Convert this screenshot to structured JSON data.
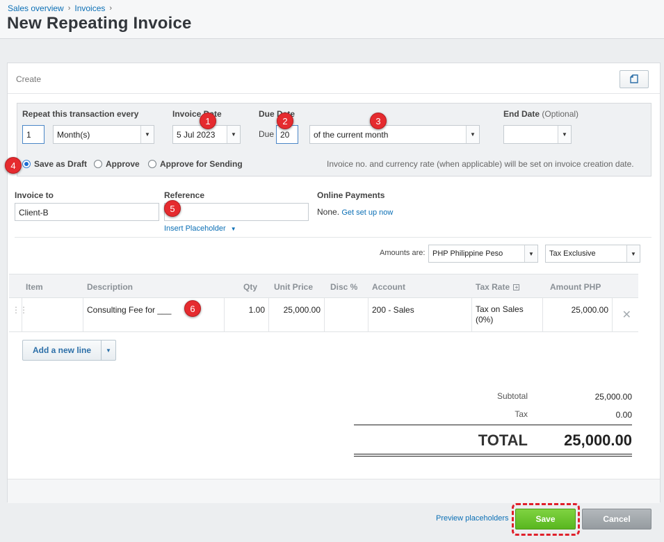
{
  "breadcrumb": {
    "item1": "Sales overview",
    "item2": "Invoices",
    "sep": "›"
  },
  "page_title": "New Repeating Invoice",
  "panel": {
    "header_label": "Create",
    "copy_icon": "copy-icon"
  },
  "repeat": {
    "repeat_label": "Repeat this transaction every",
    "interval_value": "1",
    "period_value": "Month(s)",
    "invoice_date_label": "Invoice Date",
    "invoice_date_value": "5 Jul 2023",
    "due_date_label": "Due Date",
    "due_prefix": "Due",
    "due_day_value": "20",
    "due_rule_value": "of the current month",
    "end_date_label": "End Date",
    "end_date_optional": "(Optional)",
    "end_date_value": ""
  },
  "approval": {
    "save_as_draft": "Save as Draft",
    "approve": "Approve",
    "approve_for_sending": "Approve for Sending",
    "selected": "Save as Draft",
    "note": "Invoice no. and currency rate (when applicable) will be set on invoice creation date."
  },
  "invoice": {
    "invoice_to_label": "Invoice to",
    "invoice_to_value": "Client-B",
    "reference_label": "Reference",
    "reference_value": "",
    "insert_placeholder": "Insert Placeholder",
    "online_payments_label": "Online Payments",
    "online_payments_none": "None.",
    "get_set_up": "Get set up now"
  },
  "amounts": {
    "amounts_are_label": "Amounts are:",
    "currency_value": "PHP Philippine Peso",
    "tax_mode_value": "Tax Exclusive"
  },
  "table": {
    "headers": [
      "Item",
      "Description",
      "Qty",
      "Unit Price",
      "Disc %",
      "Account",
      "Tax Rate",
      "Amount PHP"
    ],
    "rows": [
      {
        "item": "",
        "description": "Consulting Fee for ___",
        "qty": "1.00",
        "unit_price": "25,000.00",
        "disc": "",
        "account": "200 - Sales",
        "tax_rate": "Tax on Sales (0%)",
        "amount": "25,000.00"
      }
    ],
    "add_line": "Add a new line"
  },
  "totals": {
    "subtotal_label": "Subtotal",
    "subtotal_value": "25,000.00",
    "tax_label": "Tax",
    "tax_value": "0.00",
    "total_label": "TOTAL",
    "total_value": "25,000.00"
  },
  "footer": {
    "preview_placeholders": "Preview placeholders",
    "save": "Save",
    "cancel": "Cancel"
  },
  "annotations": [
    "1",
    "2",
    "3",
    "4",
    "5",
    "6"
  ],
  "colors": {
    "link": "#0b6fb5",
    "save_green": "#5fb823",
    "badge_red": "#e52b2f",
    "highlight_red": "#e0202b"
  }
}
